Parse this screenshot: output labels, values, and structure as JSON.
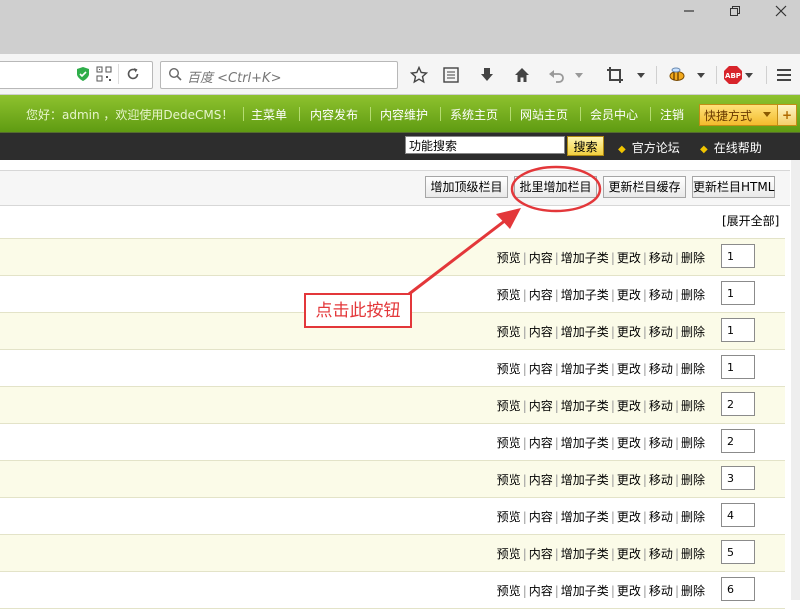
{
  "titlebar": {
    "minimize_icon": "minimize-icon",
    "restore_icon": "restore-icon"
  },
  "browser": {
    "search_placeholder": "百度 <Ctrl+K>"
  },
  "cms_nav": {
    "greeting": "您好：admin ，欢迎使用DedeCMS！",
    "links": [
      "主菜单",
      "内容发布",
      "内容维护",
      "系统主页",
      "网站主页",
      "会员中心",
      "注销"
    ],
    "quick_label": "快捷方式",
    "quick_plus": "+"
  },
  "sub_bar": {
    "search_value": "功能搜索",
    "search_button": "搜索",
    "forum_link": "官方论坛",
    "help_link": "在线帮助"
  },
  "actions": {
    "add_top": "增加顶级栏目",
    "batch_add": "批里增加栏目",
    "update_cache": "更新栏目缓存",
    "update_html": "更新栏目HTML"
  },
  "expand_all": "[展开全部]",
  "row_ops": [
    "预览",
    "内容",
    "增加子类",
    "更改",
    "移动",
    "删除"
  ],
  "rows": [
    {
      "sort": "1"
    },
    {
      "sort": "1"
    },
    {
      "sort": "1"
    },
    {
      "sort": "1"
    },
    {
      "sort": "2"
    },
    {
      "sort": "2"
    },
    {
      "sort": "3"
    },
    {
      "sort": "4"
    },
    {
      "sort": "5"
    },
    {
      "sort": "6"
    }
  ],
  "annotation": {
    "text": "点击此按钮"
  },
  "colors": {
    "accent_red": "#e3373a",
    "nav_green": "#6aa318"
  }
}
